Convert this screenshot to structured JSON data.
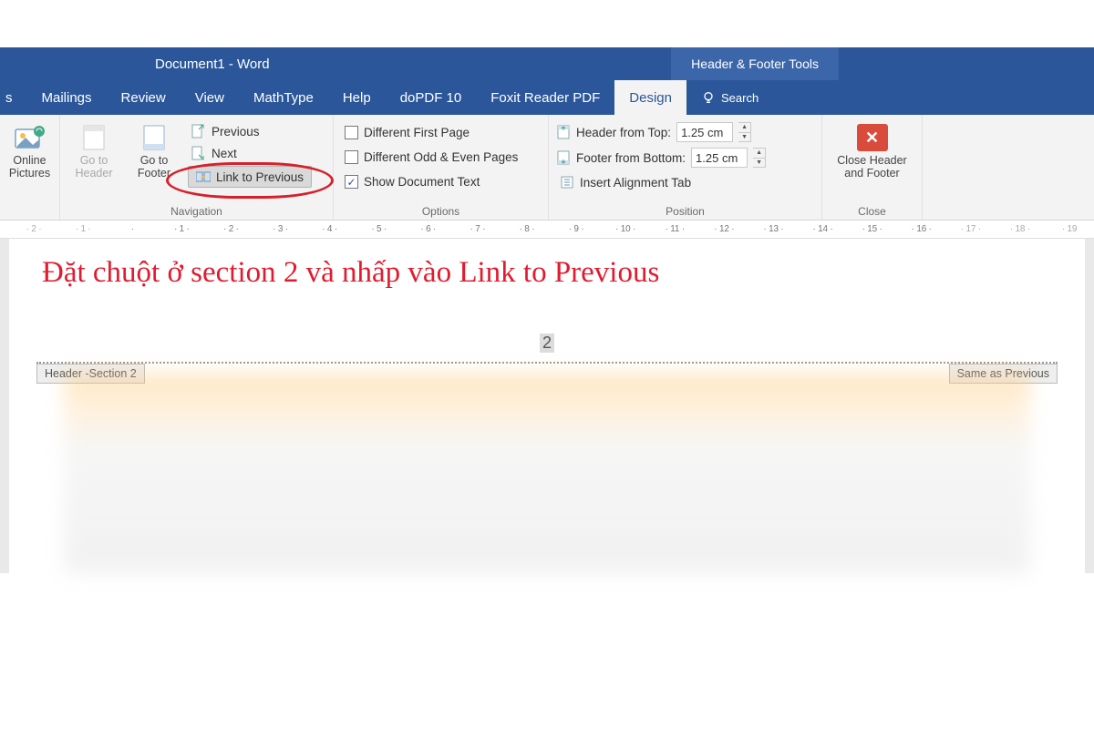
{
  "titlebar": {
    "doc_title": "Document1  -  Word",
    "tools_tab": "Header & Footer Tools"
  },
  "tabs": {
    "items": [
      "Mailings",
      "Review",
      "View",
      "MathType",
      "Help",
      "doPDF 10",
      "Foxit Reader PDF"
    ],
    "active": "Design",
    "search": "Search"
  },
  "ribbon": {
    "insert": {
      "online_pictures": "Online Pictures"
    },
    "navigation": {
      "go_header": "Go to Header",
      "go_footer": "Go to Footer",
      "previous": "Previous",
      "next": "Next",
      "link_previous": "Link to Previous",
      "label": "Navigation"
    },
    "options": {
      "diff_first": "Different First Page",
      "diff_odd_even": "Different Odd & Even Pages",
      "show_doc_text": "Show Document Text",
      "show_doc_text_checked": true,
      "label": "Options"
    },
    "position": {
      "header_top": "Header from Top:",
      "header_top_val": "1.25 cm",
      "footer_bottom": "Footer from Bottom:",
      "footer_bottom_val": "1.25 cm",
      "insert_align_tab": "Insert Alignment Tab",
      "label": "Position"
    },
    "close": {
      "btn": "Close Header and Footer",
      "label": "Close"
    }
  },
  "ruler": {
    "marks": [
      "· 2 ·",
      "· 1 ·",
      "·",
      "· 1 ·",
      "· 2 ·",
      "· 3 ·",
      "· 4 ·",
      "· 5 ·",
      "· 6 ·",
      "· 7 ·",
      "· 8 ·",
      "· 9 ·",
      "· 10 ·",
      "· 11 ·",
      "· 12 ·",
      "· 13 ·",
      "· 14 ·",
      "· 15 ·",
      "· 16 ·",
      "· 17 ·",
      "· 18 ·",
      "· 19"
    ]
  },
  "document": {
    "annotation": "Đặt chuột ở section 2 và nhấp vào Link to Previous",
    "page_number": "2",
    "header_tag_left": "Header -Section 2",
    "header_tag_right": "Same as Previous"
  }
}
